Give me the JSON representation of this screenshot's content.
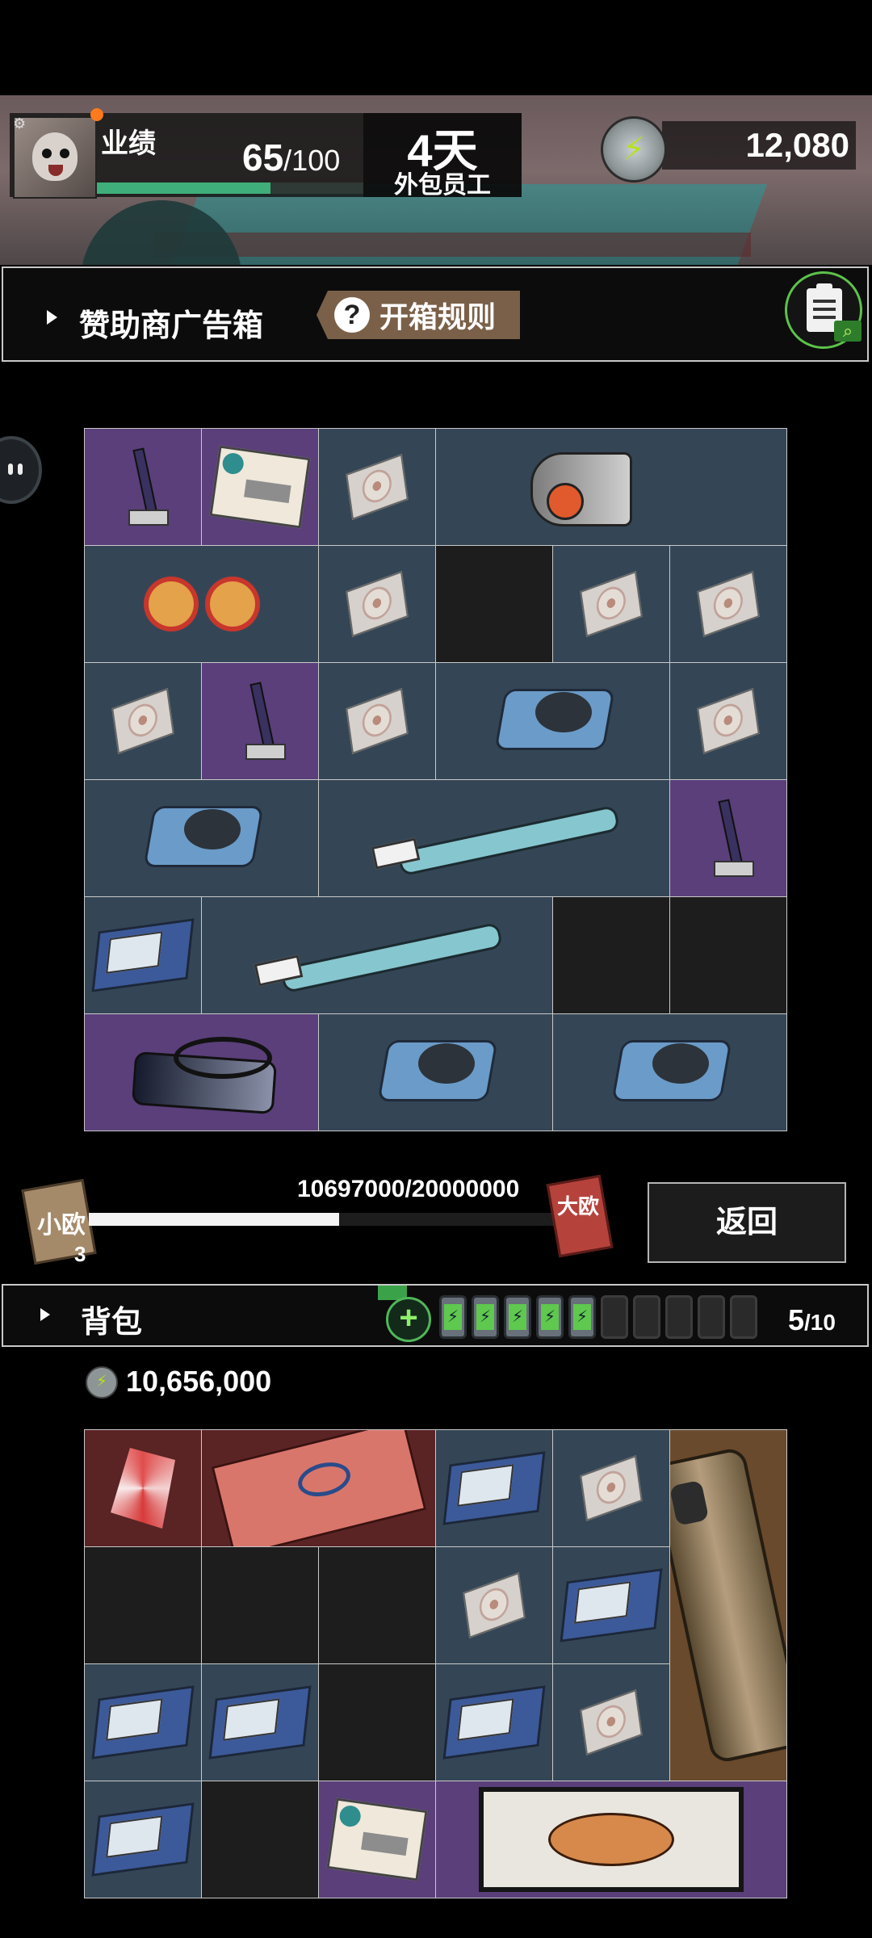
{
  "header": {
    "performance_label": "业绩",
    "performance_value": "65",
    "performance_max": "/100",
    "performance_fraction": 0.65,
    "days": "4天",
    "role": "外包员工",
    "currency_value": "12,080",
    "currency_icon": "lightning-coin-icon"
  },
  "sponsor": {
    "title": "赞助商广告箱",
    "rules_icon": "?",
    "rules_label": "开箱规则",
    "clipboard_icon": "clipboard-search-icon"
  },
  "progress": {
    "small_ticket_label": "小欧",
    "small_ticket_count": "3",
    "text": "10697000/20000000",
    "fraction": 0.535,
    "big_ticket_label": "大欧",
    "back_label": "返回"
  },
  "backpack": {
    "title": "背包",
    "add_icon": "+",
    "batteries_full": 5,
    "batteries_total": 10,
    "count": "5",
    "count_max": "/10",
    "balance": "10,656,000"
  },
  "colors": {
    "slate": "#344656",
    "purple": "#5a3f7a",
    "accent_green": "#3fae7a",
    "brown_tag": "#7a6048"
  }
}
